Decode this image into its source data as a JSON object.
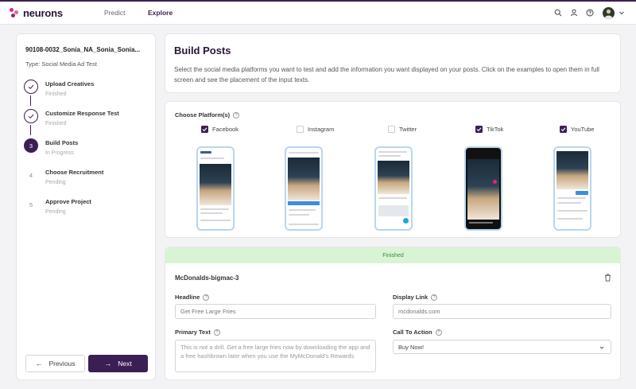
{
  "app": {
    "logo_text": "neurons",
    "nav": {
      "predict": "Predict",
      "explore": "Explore"
    },
    "icons": [
      "search-icon",
      "user-icon",
      "help-icon"
    ]
  },
  "sidebar": {
    "project_title": "90108-0032_Sonia_NA_Sonia_Sonia...",
    "project_type": "Type: Social Media Ad Test",
    "steps": [
      {
        "number": "",
        "label": "Upload Creatives",
        "status": "Finished",
        "state": "done"
      },
      {
        "number": "",
        "label": "Customize Response Test",
        "status": "Finished",
        "state": "done"
      },
      {
        "number": "3",
        "label": "Build Posts",
        "status": "In Progress",
        "state": "current"
      },
      {
        "number": "4",
        "label": "Choose Recruitment",
        "status": "Pending",
        "state": "pending"
      },
      {
        "number": "5",
        "label": "Approve Project",
        "status": "Pending",
        "state": "pending"
      }
    ],
    "prev_label": "Previous",
    "next_label": "Next"
  },
  "build": {
    "title": "Build Posts",
    "description": "Select the social media platforms you want to test and add the information you want displayed on your posts. Click on the examples to open them in full screen and see the placement of the input texts."
  },
  "platforms": {
    "label": "Choose Platform(s)",
    "items": [
      {
        "name": "Facebook",
        "checked": true
      },
      {
        "name": "Instagram",
        "checked": false
      },
      {
        "name": "Twitter",
        "checked": false
      },
      {
        "name": "TikTok",
        "checked": true
      },
      {
        "name": "YouTube",
        "checked": true
      }
    ]
  },
  "ad": {
    "banner": "Finished",
    "name": "McDonalds-bigmac-3",
    "headline_label": "Headline",
    "headline_placeholder": "Get Free Large Fries",
    "display_link_label": "Display Link",
    "display_link_placeholder": "mcdonalds.com",
    "primary_text_label": "Primary Text",
    "primary_text_placeholder": "This is not a drill. Get a free large fries now by downloading the app and a free hashbrown later when you use the MyMcDonald's Rewards",
    "cta_label": "Call To Action",
    "cta_value": "Buy Now!"
  },
  "colors": {
    "brand": "#3b1e54",
    "success_bg": "#d9f4d4",
    "success_text": "#3a8a3a"
  }
}
